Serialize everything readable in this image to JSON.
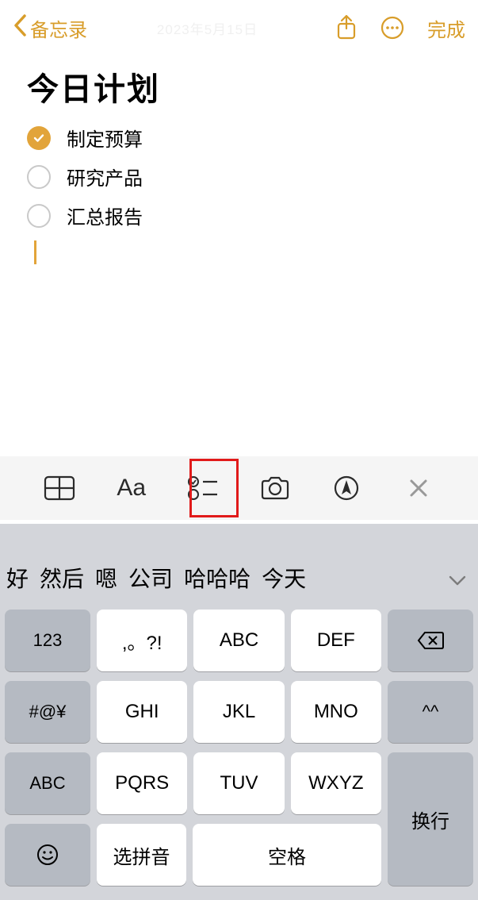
{
  "nav": {
    "back_label": "备忘录",
    "timestamp": "2023年5月15日",
    "done_label": "完成"
  },
  "note": {
    "title": "今日计划",
    "items": [
      {
        "text": "制定预算",
        "checked": true
      },
      {
        "text": "研究产品",
        "checked": false
      },
      {
        "text": "汇总报告",
        "checked": false
      }
    ]
  },
  "toolbar": {
    "aa_label": "Aa"
  },
  "keyboard": {
    "suggestions": [
      "好",
      "然后",
      "嗯",
      "公司",
      "哈哈哈",
      "今天"
    ],
    "keys": {
      "num": "123",
      "punct": ",。?!",
      "abc1": "ABC",
      "def": "DEF",
      "sym": "#@¥",
      "ghi": "GHI",
      "jkl": "JKL",
      "mno": "MNO",
      "face": "^^",
      "abc2": "ABC",
      "pqrs": "PQRS",
      "tuv": "TUV",
      "wxyz": "WXYZ",
      "enter": "换行",
      "select": "选拼音",
      "space": "空格",
      "emoji": "☺"
    }
  }
}
